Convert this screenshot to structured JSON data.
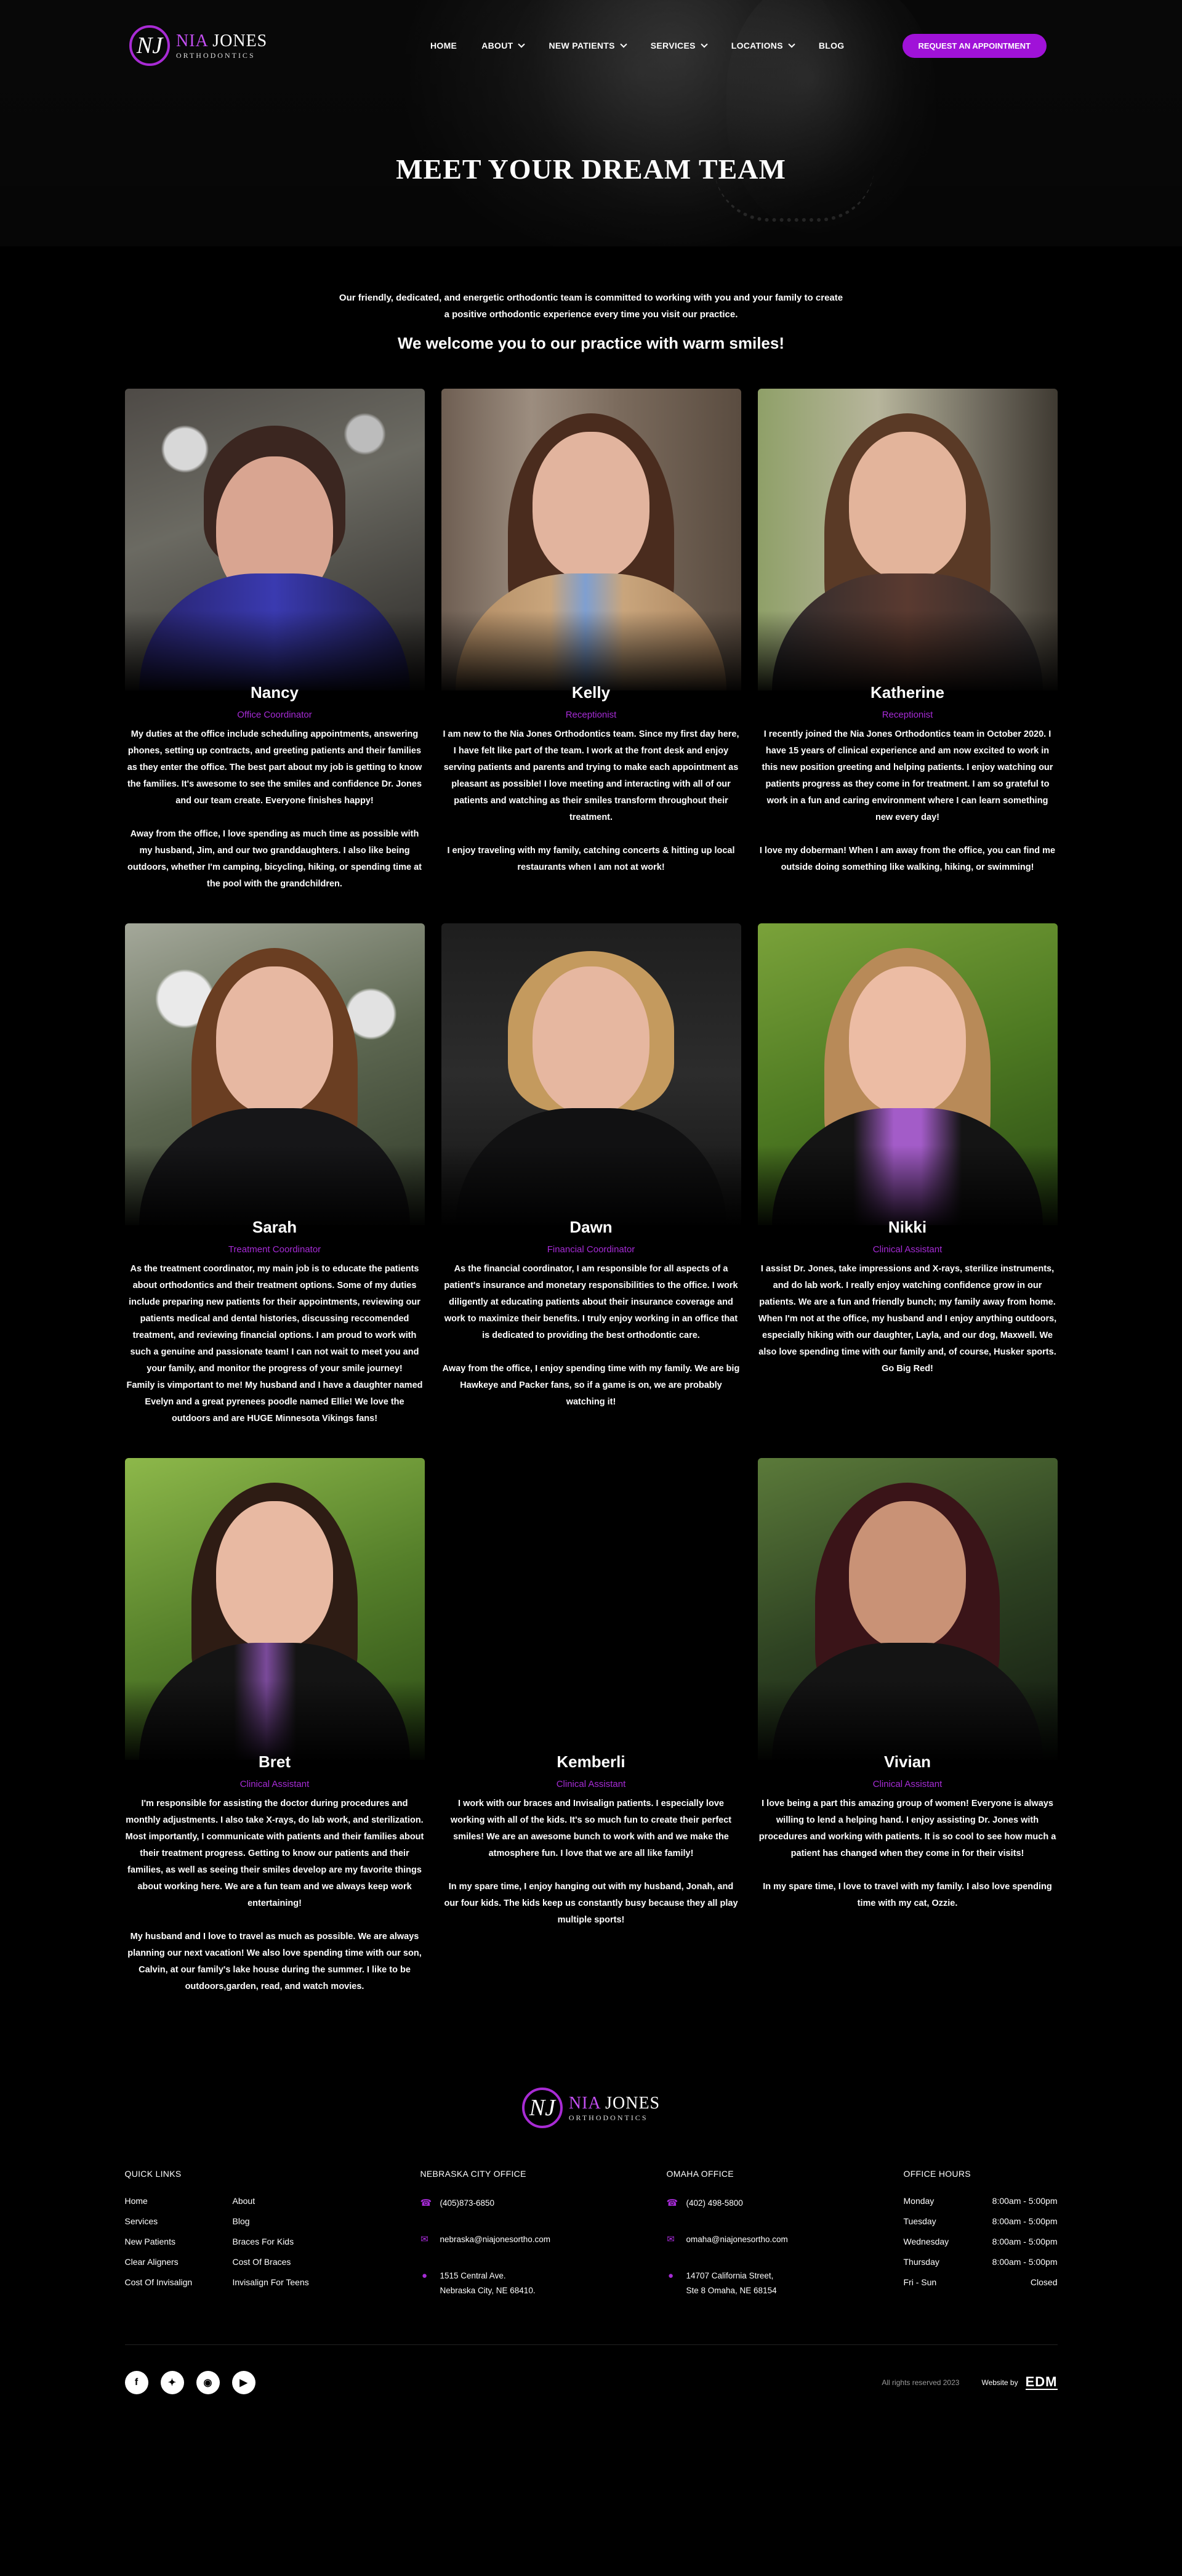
{
  "brand": {
    "monogram": "NJ",
    "name_part1": "NIA",
    "name_part2": "JONES",
    "tagline": "ORTHODONTICS"
  },
  "nav": {
    "items": [
      {
        "label": "HOME",
        "dropdown": false
      },
      {
        "label": "ABOUT",
        "dropdown": true
      },
      {
        "label": "NEW PATIENTS",
        "dropdown": true
      },
      {
        "label": "SERVICES",
        "dropdown": true
      },
      {
        "label": "LOCATIONS",
        "dropdown": true
      },
      {
        "label": "BLOG",
        "dropdown": false
      }
    ],
    "cta_label": "REQUEST AN APPOINTMENT"
  },
  "hero": {
    "title": "MEET YOUR DREAM TEAM"
  },
  "intro": {
    "text": "Our friendly, dedicated, and energetic orthodontic team is committed to working with you and your family to create a positive orthodontic experience every time you visit our practice.",
    "heading": "We welcome you to our practice with warm smiles!"
  },
  "team": [
    {
      "name": "Nancy",
      "role": "Office Coordinator",
      "photo": "portrait-nancy",
      "bio": "My duties at the office include scheduling appointments, answering phones, setting up contracts, and greeting patients and their families as they enter the office. The best part about my job is getting to know the families. It's awesome to see the smiles and confidence Dr. Jones and our team create. Everyone finishes happy!\n\nAway from the office, I love spending as much time as possible with my husband, Jim, and our two granddaughters. I also like being outdoors, whether I'm camping, bicycling, hiking, or spending time at the pool with the grandchildren."
    },
    {
      "name": "Kelly",
      "role": "Receptionist",
      "photo": "portrait-kelly",
      "bio": "I am new to the Nia Jones Orthodontics team. Since my first day here, I have felt like part of the team. I work at the front desk and enjoy serving patients and parents and trying to make each appointment as pleasant as possible! I love meeting and interacting with all of our patients and watching as their smiles transform throughout their treatment.\n\nI enjoy traveling with my family, catching concerts & hitting up local restaurants when I am not at work!"
    },
    {
      "name": "Katherine",
      "role": "Receptionist",
      "photo": "portrait-katherine",
      "bio": "I recently joined the Nia Jones Orthodontics team in October 2020. I have 15 years of clinical experience and am now excited to work in this new position greeting and helping patients. I enjoy watching our patients progress as they come in for treatment. I am so grateful to work in a fun and caring environment where I can learn something new every day!\n\nI love my doberman! When I am away from the office, you can find me outside doing something like walking, hiking, or swimming!"
    },
    {
      "name": "Sarah",
      "role": "Treatment Coordinator",
      "photo": "portrait-sarah",
      "bio": "As the treatment coordinator, my main job is to educate the patients about orthodontics and their treatment options. Some of my duties include preparing new patients for their appointments, reviewing our patients medical and dental histories, discussing reccomended treatment, and reviewing financial options. I am proud to work with such a genuine and passionate team! I can not wait to meet you and your family, and monitor the progress of your smile journey!\nFamily is vimportant to me! My husband and I have a daughter named Evelyn and a great pyrenees poodle named Ellie! We love the outdoors and are HUGE Minnesota Vikings fans!"
    },
    {
      "name": "Dawn",
      "role": "Financial Coordinator",
      "photo": "portrait-dawn",
      "bio": "As the financial coordinator, I am responsible for all aspects of a patient's insurance and monetary responsibilities to the office. I work diligently at educating patients about their insurance coverage and work to maximize their benefits. I truly enjoy working in an office that is dedicated to providing the best orthodontic care.\n\nAway from the office, I enjoy spending time with my family. We are big Hawkeye and Packer fans, so if a game is on, we are probably watching it!"
    },
    {
      "name": "Nikki",
      "role": "Clinical Assistant",
      "photo": "portrait-nikki",
      "bio": "I assist Dr. Jones, take impressions and X-rays, sterilize instruments, and do lab work. I really enjoy watching confidence grow in our patients. We are a fun and friendly bunch; my family away from home.\nWhen I'm not at the office, my husband and I enjoy anything outdoors, especially hiking with our daughter, Layla, and our dog, Maxwell. We also love spending time with our family and, of course, Husker sports. Go Big Red!"
    },
    {
      "name": "Bret",
      "role": "Clinical Assistant",
      "photo": "portrait-bret",
      "bio": "I'm responsible for assisting the doctor during procedures and monthly adjustments. I also take X-rays, do lab work, and sterilization. Most importantly, I communicate with patients and their families about their treatment progress. Getting to know our patients and their families, as well as seeing their smiles develop are my favorite things about working here. We are a fun team and we always keep work entertaining!\n\nMy husband and I love to travel as much as possible. We are always planning our next vacation! We also love spending time with our son, Calvin, at our family's lake house during the summer. I like to be outdoors,garden, read, and watch movies."
    },
    {
      "name": "Kemberli",
      "role": "Clinical Assistant",
      "photo": "",
      "bio": "I work with our braces and Invisalign patients. I especially love working with all of the kids. It's so much fun to create their perfect smiles! We are an awesome bunch to work with and we make the atmosphere fun. I love that we are all like family!\n\nIn my spare time, I enjoy hanging out with my husband, Jonah, and our four kids. The kids keep us constantly busy because they all play multiple sports!"
    },
    {
      "name": "Vivian",
      "role": "Clinical Assistant",
      "photo": "portrait-vivian",
      "bio": "I love being a part this amazing group of women! Everyone is always willing to lend a helping hand. I enjoy assisting Dr. Jones with procedures and working with patients. It is so cool to see how much a patient has changed when they come in for their visits!\n\nIn my spare time, I love to travel with my family. I also love spending time with my cat, Ozzie."
    }
  ],
  "footer": {
    "quick_links_title": "QUICK LINKS",
    "quick_links": [
      "Home",
      "About",
      "Services",
      "Blog",
      "New Patients",
      "Braces For Kids",
      "Clear Aligners",
      "Cost Of Braces",
      "Cost Of Invisalign",
      "Invisalign For Teens"
    ],
    "office1": {
      "title": "NEBRASKA CITY OFFICE",
      "phone": "(405)873-6850",
      "email": "nebraska@niajonesortho.com",
      "address_line1": "1515 Central Ave.",
      "address_line2": "Nebraska City, NE 68410."
    },
    "office2": {
      "title": "OMAHA OFFICE",
      "phone": "(402) 498-5800",
      "email": "omaha@niajonesortho.com",
      "address_line1": "14707 California Street,",
      "address_line2": "Ste 8 Omaha, NE 68154"
    },
    "hours_title": "OFFICE HOURS",
    "hours": [
      {
        "day": "Monday",
        "time": "8:00am - 5:00pm"
      },
      {
        "day": "Tuesday",
        "time": "8:00am - 5:00pm"
      },
      {
        "day": "Wednesday",
        "time": "8:00am - 5:00pm"
      },
      {
        "day": "Thursday",
        "time": "8:00am - 5:00pm"
      },
      {
        "day": "Fri - Sun",
        "time": "Closed"
      }
    ],
    "socials": [
      "facebook-icon",
      "twitter-icon",
      "instagram-icon",
      "youtube-icon"
    ],
    "rights": "All rights reserved 2023",
    "credit_label": "Website by",
    "credit_brand": "EDM"
  },
  "colors": {
    "accent": "#a012d8",
    "accent_text": "#a62bd6",
    "background": "#000000"
  }
}
